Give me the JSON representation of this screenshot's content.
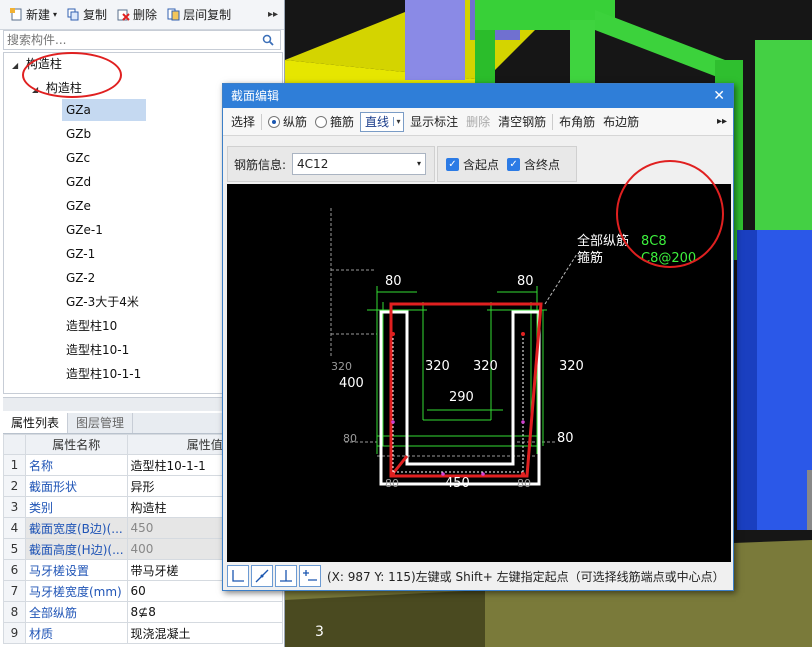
{
  "left_panel": {
    "toolbar": {
      "new_label": "新建",
      "copy_label": "复制",
      "delete_label": "删除",
      "layer_copy_label": "层间复制"
    },
    "search": {
      "placeholder": "搜索构件..."
    },
    "tree": {
      "root": "构造柱",
      "group": "构造柱",
      "items": [
        "GZa",
        "GZb",
        "GZc",
        "GZd",
        "GZe",
        "GZe-1",
        "GZ-1",
        "GZ-2",
        "GZ-3大于4米",
        "造型柱10",
        "造型柱10-1",
        "造型柱10-1-1"
      ],
      "selected": "GZa"
    },
    "tabs": {
      "props": "属性列表",
      "layers": "图层管理"
    },
    "props": {
      "col_name": "属性名称",
      "col_value": "属性值",
      "rows": [
        {
          "idx": "1",
          "name": "名称",
          "value": "造型柱10-1-1"
        },
        {
          "idx": "2",
          "name": "截面形状",
          "value": "异形"
        },
        {
          "idx": "3",
          "name": "类别",
          "value": "构造柱"
        },
        {
          "idx": "4",
          "name": "截面宽度(B边)(...",
          "value": "450"
        },
        {
          "idx": "5",
          "name": "截面高度(H边)(...",
          "value": "400"
        },
        {
          "idx": "6",
          "name": "马牙槎设置",
          "value": "带马牙槎"
        },
        {
          "idx": "7",
          "name": "马牙槎宽度(mm)",
          "value": "60"
        },
        {
          "idx": "8",
          "name": "全部纵筋",
          "value": "8⊈8"
        },
        {
          "idx": "9",
          "name": "材质",
          "value": "现浇混凝土"
        }
      ]
    }
  },
  "dialog": {
    "title": "截面编辑",
    "toolbar": {
      "select": "选择",
      "longitudinal": "纵筋",
      "stirrup": "箍筋",
      "line_mode": "直线",
      "show_label": "显示标注",
      "delete": "删除",
      "clear": "清空钢筋",
      "corner": "布角筋",
      "edge": "布边筋"
    },
    "rebar_info_label": "钢筋信息:",
    "rebar_info_value": "4C12",
    "check_start": "含起点",
    "check_end": "含终点",
    "drawing": {
      "label_all_long": "全部纵筋",
      "label_stirrup": "箍筋",
      "value_all_long": "8C8",
      "value_stirrup": "C8@200",
      "dims": {
        "top_left": "80",
        "top_right": "80",
        "inner_left": "320",
        "inner_right": "320",
        "right": "320",
        "left_outer": "320",
        "left_total": "400",
        "inner_width": "290",
        "bottom_left_h": "80",
        "bottom_right_h": "80",
        "bottom_left_w": "80",
        "bottom_right_w": "80",
        "total_width": "450"
      }
    },
    "status_text": "(X: 987 Y: 115)左键或 Shift+ 左键指定起点（可选择线筋端点或中心点）"
  },
  "viewport": {
    "label": "3"
  }
}
